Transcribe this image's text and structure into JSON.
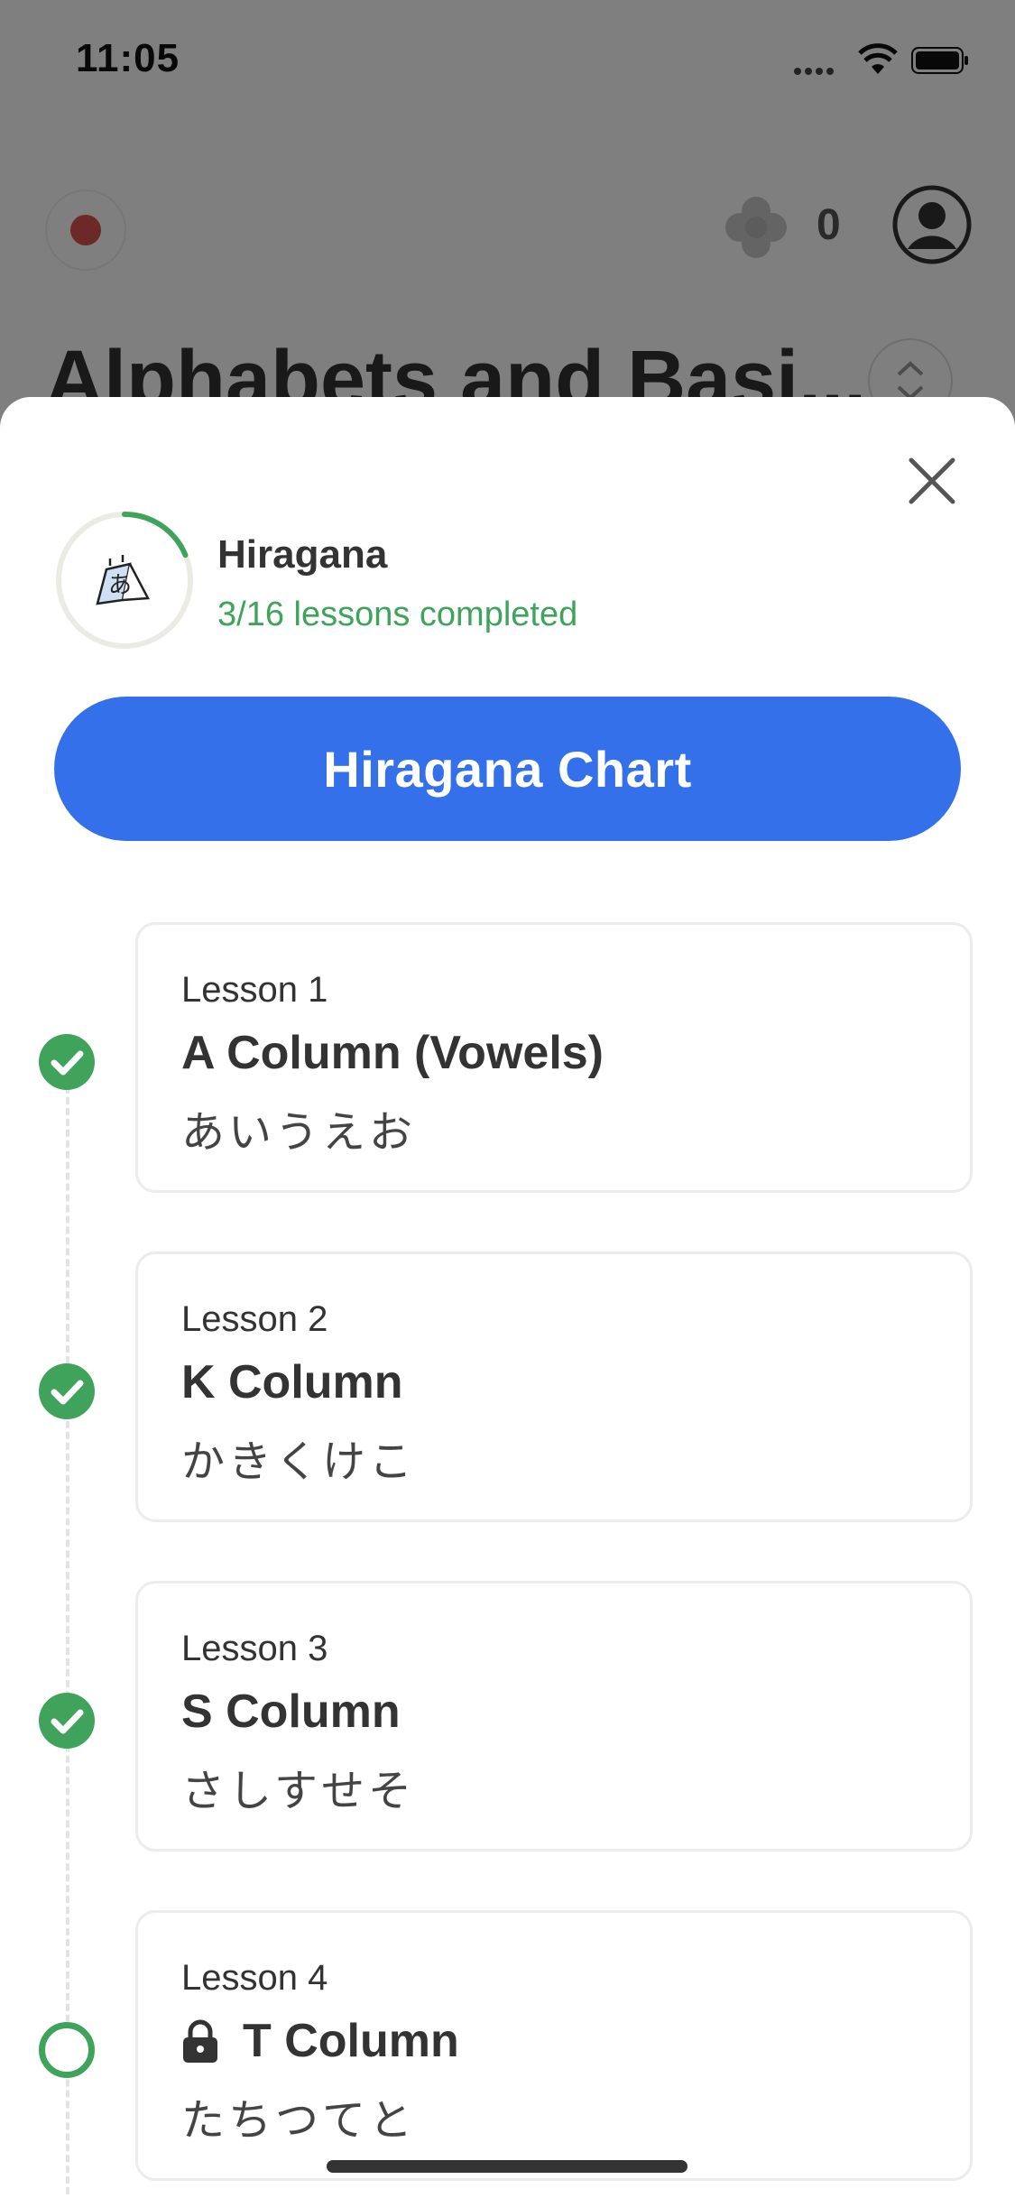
{
  "status_bar": {
    "time": "11:05"
  },
  "header": {
    "gem_count": "0",
    "title": "Alphabets and Basi..."
  },
  "sheet": {
    "course_title": "Hiragana",
    "course_progress": "3/16 lessons completed",
    "progress_fraction": 0.1875,
    "chart_button_label": "Hiragana Chart",
    "lessons": [
      {
        "number": "Lesson 1",
        "name": "A Column (Vowels)",
        "kana": "あいうえお",
        "completed": true,
        "locked": false
      },
      {
        "number": "Lesson 2",
        "name": "K Column",
        "kana": "かきくけこ",
        "completed": true,
        "locked": false
      },
      {
        "number": "Lesson 3",
        "name": "S Column",
        "kana": "さしすせそ",
        "completed": true,
        "locked": false
      },
      {
        "number": "Lesson 4",
        "name": "T Column",
        "kana": "たちつてと",
        "completed": false,
        "locked": true
      }
    ]
  },
  "colors": {
    "accent_blue": "#3470ea",
    "success_green": "#3fa35b",
    "record_red": "#d9534f"
  }
}
